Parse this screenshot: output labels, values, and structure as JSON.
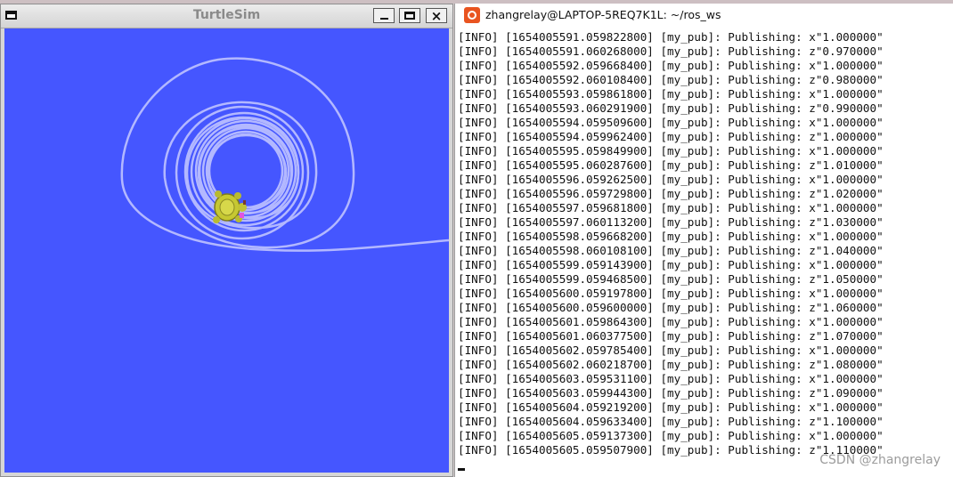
{
  "turtlesim": {
    "title": "TurtleSim",
    "colors": {
      "background": "#4556ff",
      "trail": "#b3b8ff"
    },
    "buttons": {
      "minimize": "minimize",
      "maximize": "maximize",
      "close": "×"
    }
  },
  "terminal": {
    "title": "zhangrelay@LAPTOP-5REQ7K1L: ~/ros_ws",
    "lines": [
      "[INFO] [1654005591.059822800] [my_pub]: Publishing: x\"1.000000\"",
      "[INFO] [1654005591.060268000] [my_pub]: Publishing: z\"0.970000\"",
      "[INFO] [1654005592.059668400] [my_pub]: Publishing: x\"1.000000\"",
      "[INFO] [1654005592.060108400] [my_pub]: Publishing: z\"0.980000\"",
      "[INFO] [1654005593.059861800] [my_pub]: Publishing: x\"1.000000\"",
      "[INFO] [1654005593.060291900] [my_pub]: Publishing: z\"0.990000\"",
      "[INFO] [1654005594.059509600] [my_pub]: Publishing: x\"1.000000\"",
      "[INFO] [1654005594.059962400] [my_pub]: Publishing: z\"1.000000\"",
      "[INFO] [1654005595.059849900] [my_pub]: Publishing: x\"1.000000\"",
      "[INFO] [1654005595.060287600] [my_pub]: Publishing: z\"1.010000\"",
      "[INFO] [1654005596.059262500] [my_pub]: Publishing: x\"1.000000\"",
      "[INFO] [1654005596.059729800] [my_pub]: Publishing: z\"1.020000\"",
      "[INFO] [1654005597.059681800] [my_pub]: Publishing: x\"1.000000\"",
      "[INFO] [1654005597.060113200] [my_pub]: Publishing: z\"1.030000\"",
      "[INFO] [1654005598.059668200] [my_pub]: Publishing: x\"1.000000\"",
      "[INFO] [1654005598.060108100] [my_pub]: Publishing: z\"1.040000\"",
      "[INFO] [1654005599.059143900] [my_pub]: Publishing: x\"1.000000\"",
      "[INFO] [1654005599.059468500] [my_pub]: Publishing: z\"1.050000\"",
      "[INFO] [1654005600.059197800] [my_pub]: Publishing: x\"1.000000\"",
      "[INFO] [1654005600.059600000] [my_pub]: Publishing: z\"1.060000\"",
      "[INFO] [1654005601.059864300] [my_pub]: Publishing: x\"1.000000\"",
      "[INFO] [1654005601.060377500] [my_pub]: Publishing: z\"1.070000\"",
      "[INFO] [1654005602.059785400] [my_pub]: Publishing: x\"1.000000\"",
      "[INFO] [1654005602.060218700] [my_pub]: Publishing: z\"1.080000\"",
      "[INFO] [1654005603.059531100] [my_pub]: Publishing: x\"1.000000\"",
      "[INFO] [1654005603.059944300] [my_pub]: Publishing: z\"1.090000\"",
      "[INFO] [1654005604.059219200] [my_pub]: Publishing: x\"1.000000\"",
      "[INFO] [1654005604.059633400] [my_pub]: Publishing: z\"1.100000\"",
      "[INFO] [1654005605.059137300] [my_pub]: Publishing: x\"1.000000\"",
      "[INFO] [1654005605.059507900] [my_pub]: Publishing: z\"1.110000\""
    ]
  },
  "watermark": "CSDN @zhangrelay"
}
